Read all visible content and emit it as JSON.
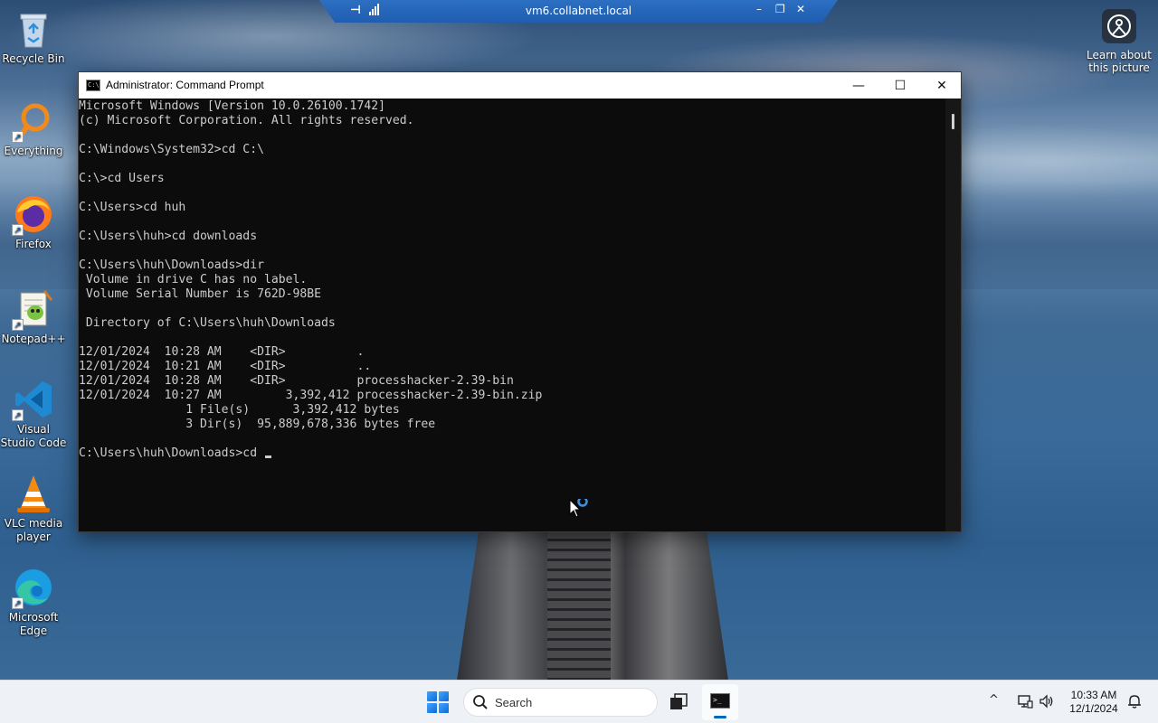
{
  "rdp": {
    "host": "vm6.collabnet.local",
    "pin_glyph": "⊣",
    "min_glyph": "–",
    "restore_glyph": "❐",
    "close_glyph": "✕"
  },
  "desktop_icons": [
    {
      "label": "Recycle Bin",
      "icon": "recycle-bin-icon"
    },
    {
      "label": "Everything",
      "icon": "everything-search-icon"
    },
    {
      "label": "Firefox",
      "icon": "firefox-icon"
    },
    {
      "label": "Notepad++",
      "icon": "notepad-plus-plus-icon"
    },
    {
      "label": "Visual Studio Code",
      "icon": "vscode-icon"
    },
    {
      "label": "VLC media player",
      "icon": "vlc-icon"
    },
    {
      "label": "Microsoft Edge",
      "icon": "edge-icon"
    }
  ],
  "learn": {
    "label": "Learn about this picture"
  },
  "cmd": {
    "title": "Administrator: Command Prompt",
    "icon_text": "C:\\",
    "minimize": "—",
    "maximize": "☐",
    "close": "✕",
    "lines": [
      "Microsoft Windows [Version 10.0.26100.1742]",
      "(c) Microsoft Corporation. All rights reserved.",
      "",
      "C:\\Windows\\System32>cd C:\\",
      "",
      "C:\\>cd Users",
      "",
      "C:\\Users>cd huh",
      "",
      "C:\\Users\\huh>cd downloads",
      "",
      "C:\\Users\\huh\\Downloads>dir",
      " Volume in drive C has no label.",
      " Volume Serial Number is 762D-98BE",
      "",
      " Directory of C:\\Users\\huh\\Downloads",
      "",
      "12/01/2024  10:28 AM    <DIR>          .",
      "12/01/2024  10:21 AM    <DIR>          ..",
      "12/01/2024  10:28 AM    <DIR>          processhacker-2.39-bin",
      "12/01/2024  10:27 AM         3,392,412 processhacker-2.39-bin.zip",
      "               1 File(s)      3,392,412 bytes",
      "               3 Dir(s)  95,889,678,336 bytes free",
      ""
    ],
    "prompt": "C:\\Users\\huh\\Downloads>cd "
  },
  "taskbar": {
    "search_label": "Search",
    "tray_chevron": "^",
    "clock_time": "10:33 AM",
    "clock_date": "12/1/2024"
  }
}
